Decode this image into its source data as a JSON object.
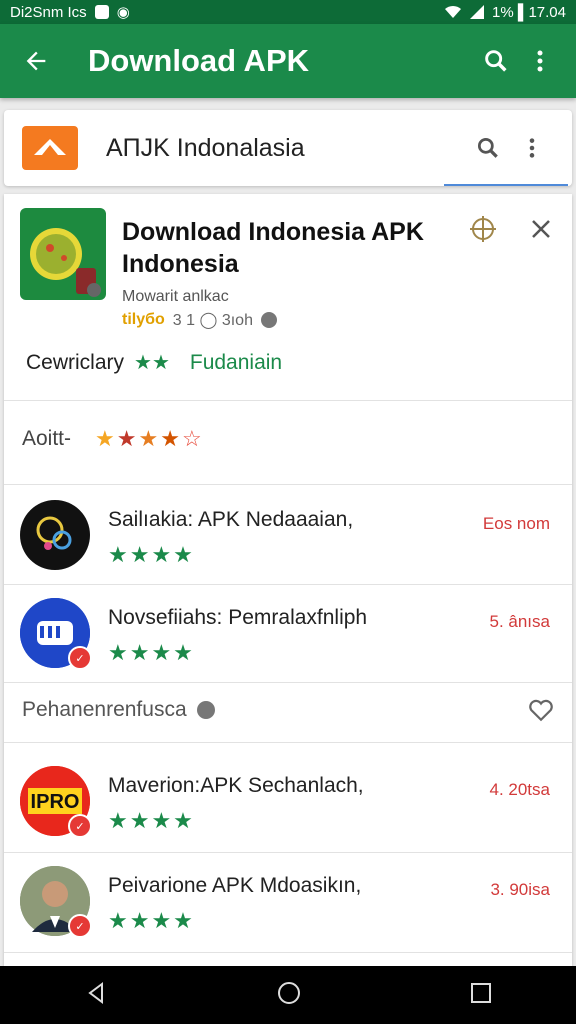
{
  "status": {
    "left_text": "Di2Snm Ics",
    "right_text": "1% ▌17.04"
  },
  "appbar": {
    "title": "Download APK",
    "back_icon": "arrow-back-icon",
    "search_icon": "search-icon",
    "menu_icon": "more-vert-icon"
  },
  "search": {
    "query": "AПJK Indonalasia",
    "app_icon": "apk-logo-icon"
  },
  "header": {
    "title": "Download Indonesia APK Indonesia",
    "subtitle": "Mowarit anlkac",
    "meta_yellow": "tilyбo",
    "meta_rest": "3 1  ◯ 3ıoh"
  },
  "category": {
    "label": "Cewriclary",
    "stars": "★★",
    "value": "Fudaniain"
  },
  "filter": {
    "label": "Aoitt-",
    "rating": 4.5
  },
  "apps": [
    {
      "name": "Sailıakia: APK Nedaaaian,",
      "meta": "Eos  nom",
      "stars": "★★★★"
    },
    {
      "name": "Novsefiiahs: Pemralaxfnliph",
      "meta": "5. ânısa",
      "stars": "★★★★"
    }
  ],
  "section": {
    "title": "Pehanenrenfusca"
  },
  "apps2": [
    {
      "name": "Maverion:APK Sechanlach,",
      "meta": "4. 20tsa",
      "stars": "★★★★"
    },
    {
      "name": "Peivarione APK Mdoasikın,",
      "meta": "3. 90isa",
      "stars": "★★★★"
    }
  ],
  "colors": {
    "statusbar": "#0d6b37",
    "appbar": "#1b8a4a",
    "accent": "#1b8a4a",
    "meta": "#d23a3a"
  }
}
